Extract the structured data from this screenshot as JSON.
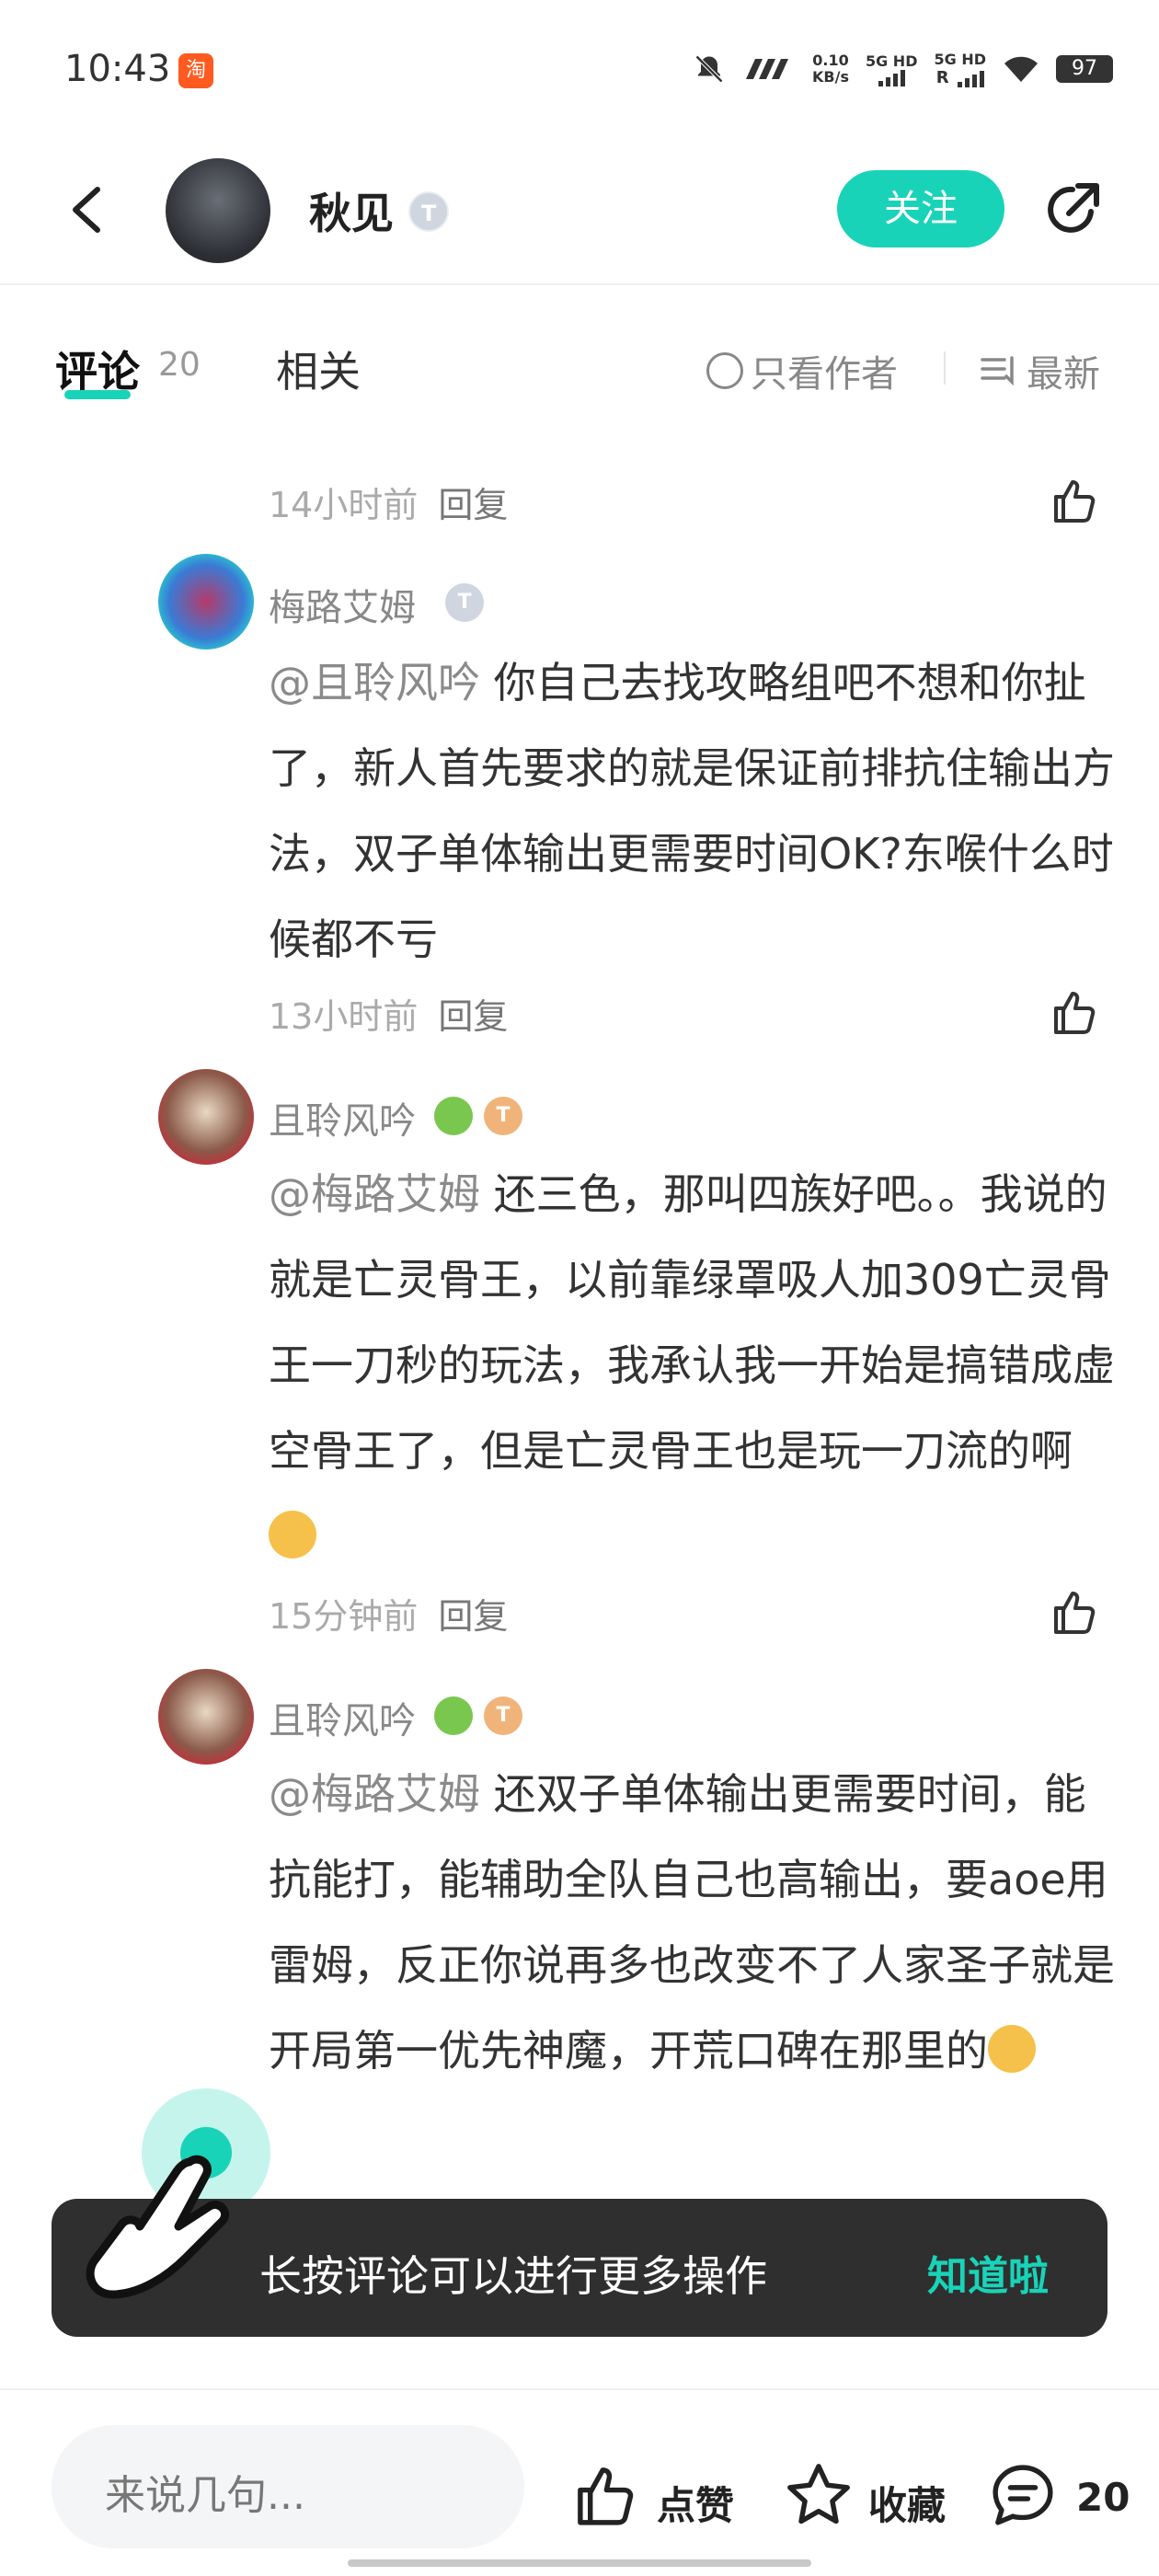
{
  "status_bar": {
    "time": "10:43",
    "app_badge": "淘",
    "net_speed_value": "0.10",
    "net_speed_unit": "KB/s",
    "sim1": "5G HD",
    "sim2": "5G HD",
    "sim2_flag": "R",
    "battery": "97"
  },
  "header": {
    "username": "秋见",
    "level_badge": "T",
    "follow_label": "关注"
  },
  "tabs": {
    "comments_label": "评论",
    "comments_count": "20",
    "related_label": "相关",
    "only_author_label": "只看作者",
    "sort_label": "最新"
  },
  "comments": [
    {
      "time": "14小时前",
      "reply_label": "回复"
    },
    {
      "name": "梅路艾姆",
      "level": "T",
      "mention": "@且聆风吟",
      "text": " 你自己去找攻略组吧不想和你扯了，新人首先要求的就是保证前排抗住输出方法，双子单体输出更需要时间OK?东喉什么时候都不亏",
      "time": "13小时前",
      "reply_label": "回复"
    },
    {
      "name": "且聆风吟",
      "level": "T",
      "mention": "@梅路艾姆",
      "text": " 还三色，那叫四族好吧。。我说的就是亡灵骨王，以前靠绿罩吸人加309亡灵骨王一刀秒的玩法，我承认我一开始是搞错成虚空骨王了，但是亡灵骨王也是玩一刀流的啊",
      "time": "15分钟前",
      "reply_label": "回复"
    },
    {
      "name": "且聆风吟",
      "level": "T",
      "mention": "@梅路艾姆",
      "text": " 还双子单体输出更需要时间，能抗能打，能辅助全队自己也高输出，要aoe用雷姆，反正你说再多也改变不了人家圣子就是开局第一优先神魔，开荒口碑在那里的"
    }
  ],
  "toast": {
    "message": "长按评论可以进行更多操作",
    "dismiss_label": "知道啦"
  },
  "bottom_bar": {
    "input_placeholder": "来说几句...",
    "like_label": "点赞",
    "favorite_label": "收藏",
    "comment_count": "20"
  },
  "colors": {
    "accent": "#19d3b8",
    "toast_bg": "#2f2f2f"
  }
}
